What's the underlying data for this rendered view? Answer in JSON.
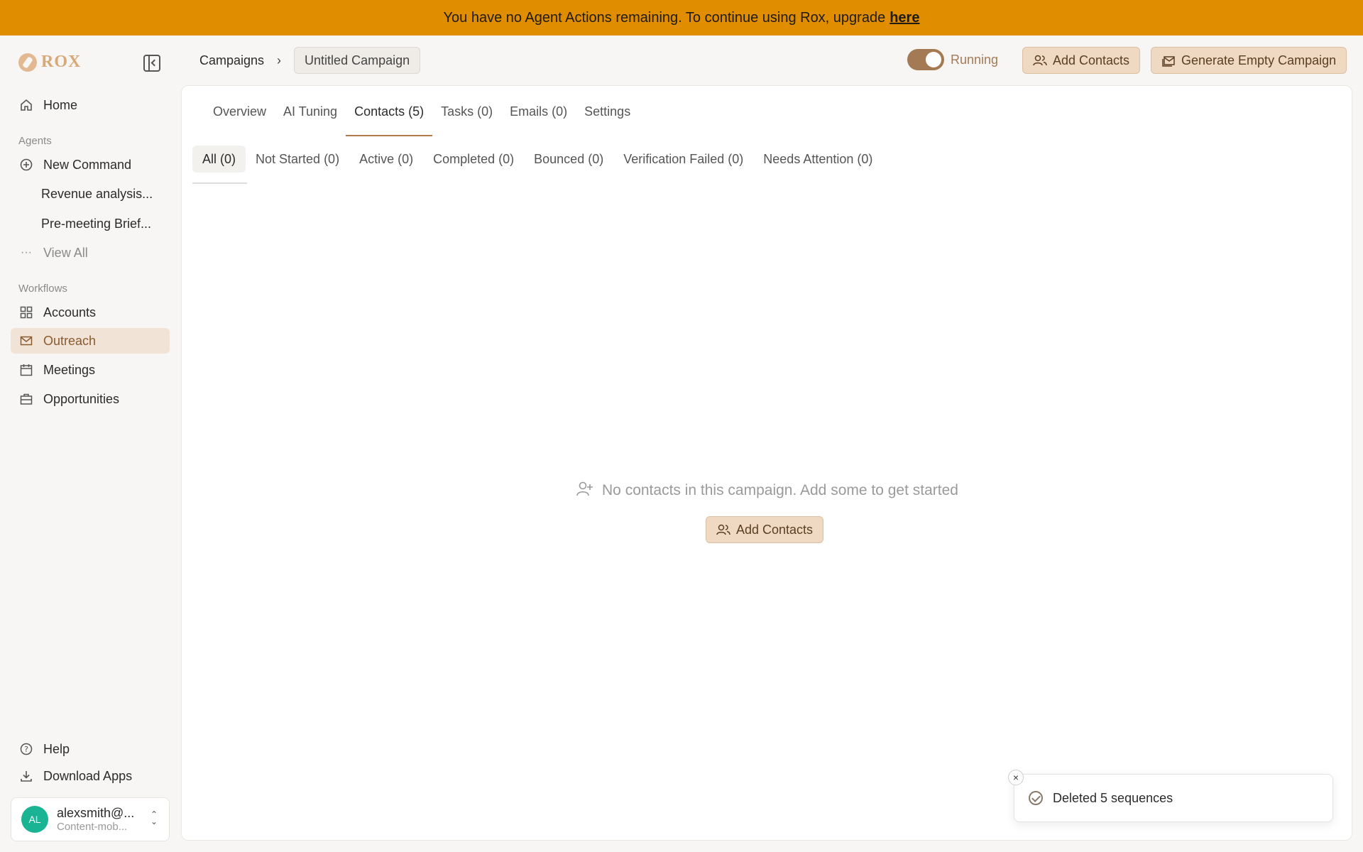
{
  "banner": {
    "text": "You have no Agent Actions remaining. To continue using Rox, upgrade",
    "link": "here",
    "color": "#e08e00"
  },
  "brand": {
    "name": "ROX",
    "accent": "#d8a877"
  },
  "sidebar": {
    "home": "Home",
    "agents_label": "Agents",
    "new_command": "New Command",
    "recent": [
      "Revenue analysis...",
      "Pre-meeting Brief..."
    ],
    "view_all": "View All",
    "workflows_label": "Workflows",
    "workflows": [
      "Accounts",
      "Outreach",
      "Meetings",
      "Opportunities"
    ],
    "help": "Help",
    "download": "Download Apps"
  },
  "user": {
    "initials": "AL",
    "email": "alexsmith@...",
    "org": "Content-mob..."
  },
  "header": {
    "breadcrumb_root": "Campaigns",
    "breadcrumb_current": "Untitled Campaign",
    "status": "Running",
    "add_contacts": "Add Contacts",
    "generate": "Generate Empty Campaign"
  },
  "tabs": [
    "Overview",
    "AI Tuning",
    "Contacts (5)",
    "Tasks (0)",
    "Emails (0)",
    "Settings"
  ],
  "filters": [
    "All (0)",
    "Not Started (0)",
    "Active (0)",
    "Completed (0)",
    "Bounced (0)",
    "Verification Failed (0)",
    "Needs Attention (0)"
  ],
  "empty": {
    "message": "No contacts in this campaign. Add some to get started",
    "button": "Add Contacts"
  },
  "toast": {
    "message": "Deleted 5 sequences"
  }
}
